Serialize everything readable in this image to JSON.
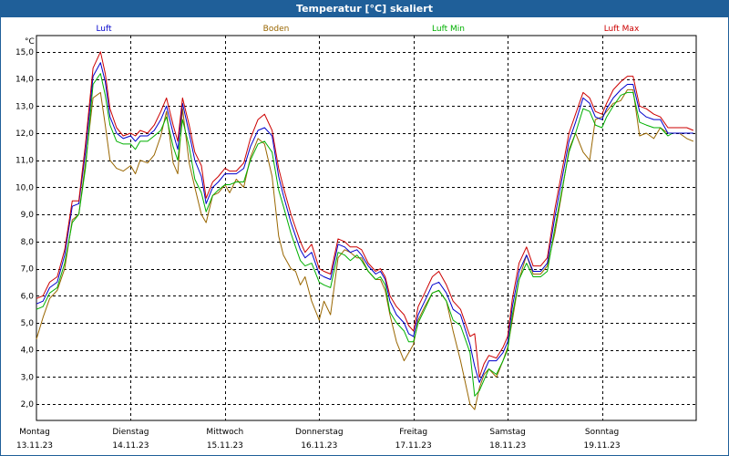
{
  "window": {
    "title": "Temperatur [°C] skaliert"
  },
  "chart_data": {
    "type": "line",
    "unit_label": "°C",
    "ylim": [
      1.4,
      15.6
    ],
    "y_ticks": [
      2.0,
      3.0,
      4.0,
      5.0,
      6.0,
      7.0,
      8.0,
      9.0,
      10.0,
      11.0,
      12.0,
      13.0,
      14.0,
      15.0
    ],
    "y_tick_labels": [
      "2,0",
      "3,0",
      "4,0",
      "5,0",
      "6,0",
      "7,0",
      "8,0",
      "9,0",
      "10,0",
      "11,0",
      "12,0",
      "13,0",
      "14,0",
      "15,0"
    ],
    "xlim": [
      0,
      7
    ],
    "x_ticks": [
      {
        "pos": 0,
        "day": "Montag",
        "date": "13.11.23"
      },
      {
        "pos": 1,
        "day": "Dienstag",
        "date": "14.11.23"
      },
      {
        "pos": 2,
        "day": "Mittwoch",
        "date": "15.11.23"
      },
      {
        "pos": 3,
        "day": "Donnerstag",
        "date": "16.11.23"
      },
      {
        "pos": 4,
        "day": "Freitag",
        "date": "17.11.23"
      },
      {
        "pos": 5,
        "day": "Samstag",
        "date": "18.11.23"
      },
      {
        "pos": 6,
        "day": "Sonntag",
        "date": "19.11.23"
      }
    ],
    "grid": true,
    "legend_position": "top",
    "series": [
      {
        "name": "Luft",
        "color": "#0000cc",
        "x": [
          0,
          0.07,
          0.14,
          0.22,
          0.3,
          0.38,
          0.45,
          0.52,
          0.6,
          0.68,
          0.73,
          0.78,
          0.85,
          0.92,
          1.0,
          1.05,
          1.1,
          1.18,
          1.25,
          1.32,
          1.38,
          1.45,
          1.5,
          1.55,
          1.62,
          1.68,
          1.75,
          1.8,
          1.87,
          1.93,
          2.0,
          2.05,
          2.12,
          2.2,
          2.27,
          2.35,
          2.42,
          2.5,
          2.57,
          2.62,
          2.7,
          2.75,
          2.8,
          2.85,
          2.92,
          3.0,
          3.05,
          3.12,
          3.2,
          3.27,
          3.33,
          3.4,
          3.45,
          3.52,
          3.6,
          3.65,
          3.7,
          3.75,
          3.82,
          3.9,
          3.95,
          4.0,
          4.05,
          4.12,
          4.2,
          4.27,
          4.35,
          4.42,
          4.5,
          4.6,
          4.65,
          4.7,
          4.75,
          4.8,
          4.88,
          4.95,
          5.0,
          5.05,
          5.12,
          5.2,
          5.27,
          5.35,
          5.42,
          5.5,
          5.57,
          5.65,
          5.72,
          5.8,
          5.87,
          5.93,
          6.0,
          6.05,
          6.12,
          6.2,
          6.27,
          6.33,
          6.4,
          6.47,
          6.55,
          6.62,
          6.7,
          6.75,
          6.82,
          6.9,
          6.97
        ],
        "y": [
          5.7,
          5.8,
          6.3,
          6.5,
          7.5,
          9.3,
          9.4,
          11.3,
          14.1,
          14.6,
          13.9,
          12.6,
          12.0,
          11.8,
          11.9,
          11.7,
          11.9,
          11.9,
          12.1,
          12.5,
          13.0,
          12.0,
          11.4,
          13.1,
          12.0,
          11.0,
          10.4,
          9.4,
          10.0,
          10.2,
          10.5,
          10.5,
          10.5,
          10.7,
          11.5,
          12.1,
          12.2,
          11.9,
          10.4,
          9.7,
          8.7,
          8.2,
          7.7,
          7.4,
          7.6,
          6.8,
          6.7,
          6.6,
          7.9,
          7.8,
          7.6,
          7.7,
          7.5,
          7.1,
          6.8,
          6.9,
          6.6,
          5.8,
          5.3,
          5.0,
          4.6,
          4.5,
          5.3,
          5.8,
          6.4,
          6.5,
          6.1,
          5.5,
          5.3,
          4.2,
          3.4,
          2.8,
          3.2,
          3.6,
          3.6,
          3.9,
          4.3,
          5.6,
          6.9,
          7.5,
          6.9,
          6.9,
          7.2,
          8.9,
          10.2,
          11.7,
          12.4,
          13.3,
          13.1,
          12.6,
          12.5,
          12.9,
          13.3,
          13.6,
          13.8,
          13.8,
          12.8,
          12.6,
          12.5,
          12.5,
          12.0,
          12.0,
          12.0,
          12.0,
          12.0
        ]
      },
      {
        "name": "Boden",
        "color": "#996600",
        "x": [
          0,
          0.07,
          0.14,
          0.22,
          0.3,
          0.38,
          0.45,
          0.52,
          0.6,
          0.68,
          0.73,
          0.78,
          0.85,
          0.92,
          1.0,
          1.05,
          1.1,
          1.18,
          1.25,
          1.32,
          1.38,
          1.45,
          1.5,
          1.55,
          1.62,
          1.68,
          1.75,
          1.8,
          1.87,
          1.93,
          2.0,
          2.05,
          2.12,
          2.2,
          2.27,
          2.35,
          2.42,
          2.5,
          2.57,
          2.62,
          2.7,
          2.75,
          2.8,
          2.85,
          2.92,
          3.0,
          3.05,
          3.12,
          3.2,
          3.27,
          3.33,
          3.4,
          3.45,
          3.52,
          3.6,
          3.65,
          3.7,
          3.75,
          3.82,
          3.9,
          3.95,
          4.0,
          4.05,
          4.12,
          4.2,
          4.27,
          4.35,
          4.42,
          4.5,
          4.6,
          4.65,
          4.7,
          4.75,
          4.8,
          4.88,
          4.95,
          5.0,
          5.05,
          5.12,
          5.2,
          5.27,
          5.35,
          5.42,
          5.5,
          5.57,
          5.65,
          5.72,
          5.8,
          5.87,
          5.93,
          6.0,
          6.05,
          6.12,
          6.2,
          6.27,
          6.33,
          6.4,
          6.47,
          6.55,
          6.62,
          6.7,
          6.75,
          6.82,
          6.9,
          6.97
        ],
        "y": [
          4.4,
          5.2,
          5.9,
          6.2,
          7.0,
          8.8,
          9.0,
          10.9,
          13.3,
          13.5,
          12.3,
          11.0,
          10.7,
          10.6,
          10.8,
          10.5,
          11.0,
          10.9,
          11.2,
          11.9,
          12.8,
          10.9,
          10.5,
          12.9,
          10.9,
          10.0,
          9.0,
          8.7,
          9.7,
          9.8,
          10.1,
          9.8,
          10.3,
          10.0,
          11.1,
          11.8,
          11.6,
          10.4,
          8.2,
          7.5,
          7.0,
          6.9,
          6.4,
          6.7,
          5.8,
          5.1,
          5.8,
          5.3,
          7.4,
          7.7,
          7.6,
          7.4,
          7.4,
          6.9,
          6.6,
          6.6,
          6.2,
          5.3,
          4.3,
          3.6,
          3.9,
          4.2,
          5.1,
          5.6,
          6.1,
          6.2,
          5.8,
          4.7,
          3.6,
          2.0,
          1.8,
          2.6,
          3.1,
          3.3,
          3.0,
          3.6,
          4.1,
          5.1,
          6.6,
          7.5,
          6.8,
          6.8,
          7.1,
          8.3,
          9.7,
          11.4,
          12.0,
          11.3,
          11.0,
          12.5,
          12.6,
          12.8,
          13.1,
          13.2,
          13.6,
          13.6,
          11.9,
          12.0,
          11.8,
          12.2,
          12.0,
          12.0,
          12.0,
          11.8,
          11.7
        ]
      },
      {
        "name": "Luft Min",
        "color": "#00b000",
        "x": [
          0,
          0.07,
          0.14,
          0.22,
          0.3,
          0.38,
          0.45,
          0.52,
          0.6,
          0.68,
          0.73,
          0.78,
          0.85,
          0.92,
          1.0,
          1.05,
          1.1,
          1.18,
          1.25,
          1.32,
          1.38,
          1.45,
          1.5,
          1.55,
          1.62,
          1.68,
          1.75,
          1.8,
          1.87,
          1.93,
          2.0,
          2.05,
          2.12,
          2.2,
          2.27,
          2.35,
          2.42,
          2.5,
          2.57,
          2.62,
          2.7,
          2.75,
          2.8,
          2.85,
          2.92,
          3.0,
          3.05,
          3.12,
          3.2,
          3.27,
          3.33,
          3.4,
          3.45,
          3.52,
          3.6,
          3.65,
          3.7,
          3.75,
          3.82,
          3.9,
          3.95,
          4.0,
          4.05,
          4.12,
          4.2,
          4.27,
          4.35,
          4.42,
          4.5,
          4.6,
          4.65,
          4.7,
          4.75,
          4.8,
          4.88,
          4.95,
          5.0,
          5.05,
          5.12,
          5.2,
          5.27,
          5.35,
          5.42,
          5.5,
          5.57,
          5.65,
          5.72,
          5.8,
          5.87,
          5.93,
          6.0,
          6.05,
          6.12,
          6.2,
          6.27,
          6.33,
          6.4,
          6.47,
          6.55,
          6.62,
          6.7,
          6.75,
          6.82,
          6.9,
          6.97
        ],
        "y": [
          5.5,
          5.6,
          6.1,
          6.3,
          7.2,
          8.7,
          9.0,
          10.7,
          13.8,
          14.2,
          13.4,
          12.3,
          11.7,
          11.6,
          11.6,
          11.4,
          11.7,
          11.7,
          11.9,
          12.1,
          12.6,
          11.5,
          11.0,
          12.5,
          11.5,
          10.3,
          9.8,
          9.1,
          9.7,
          9.9,
          10.1,
          10.1,
          10.2,
          10.2,
          11.0,
          11.6,
          11.7,
          11.3,
          9.9,
          9.3,
          8.3,
          7.8,
          7.3,
          7.1,
          7.2,
          6.5,
          6.4,
          6.3,
          7.6,
          7.5,
          7.3,
          7.5,
          7.3,
          6.9,
          6.6,
          6.7,
          6.4,
          5.4,
          5.0,
          4.7,
          4.3,
          4.3,
          5.0,
          5.5,
          6.1,
          6.2,
          5.8,
          5.1,
          4.9,
          3.9,
          2.3,
          2.5,
          2.9,
          3.3,
          3.1,
          3.6,
          4.0,
          5.3,
          6.6,
          7.2,
          6.7,
          6.7,
          6.9,
          8.5,
          9.8,
          11.3,
          12.0,
          12.9,
          12.8,
          12.3,
          12.2,
          12.6,
          13.0,
          13.4,
          13.5,
          13.5,
          12.4,
          12.3,
          12.2,
          12.2,
          11.9,
          12.0,
          12.0,
          12.0,
          12.0
        ]
      },
      {
        "name": "Luft Max",
        "color": "#cc0000",
        "x": [
          0,
          0.07,
          0.14,
          0.22,
          0.3,
          0.38,
          0.45,
          0.52,
          0.6,
          0.68,
          0.73,
          0.78,
          0.85,
          0.92,
          1.0,
          1.05,
          1.1,
          1.18,
          1.25,
          1.32,
          1.38,
          1.45,
          1.5,
          1.55,
          1.62,
          1.68,
          1.75,
          1.8,
          1.87,
          1.93,
          2.0,
          2.05,
          2.12,
          2.2,
          2.27,
          2.35,
          2.42,
          2.5,
          2.57,
          2.62,
          2.7,
          2.75,
          2.8,
          2.85,
          2.92,
          3.0,
          3.05,
          3.12,
          3.2,
          3.27,
          3.33,
          3.4,
          3.45,
          3.52,
          3.6,
          3.65,
          3.7,
          3.75,
          3.82,
          3.9,
          3.95,
          4.0,
          4.05,
          4.12,
          4.2,
          4.27,
          4.35,
          4.42,
          4.5,
          4.6,
          4.65,
          4.7,
          4.75,
          4.8,
          4.88,
          4.95,
          5.0,
          5.05,
          5.12,
          5.2,
          5.27,
          5.35,
          5.42,
          5.5,
          5.57,
          5.65,
          5.72,
          5.8,
          5.87,
          5.93,
          6.0,
          6.05,
          6.12,
          6.2,
          6.27,
          6.33,
          6.4,
          6.47,
          6.55,
          6.62,
          6.7,
          6.75,
          6.82,
          6.9,
          6.97
        ],
        "y": [
          5.9,
          6.0,
          6.5,
          6.7,
          7.7,
          9.5,
          9.5,
          11.6,
          14.4,
          15.0,
          14.2,
          12.9,
          12.2,
          11.9,
          12.0,
          11.9,
          12.1,
          12.0,
          12.3,
          12.8,
          13.3,
          12.3,
          11.7,
          13.3,
          12.3,
          11.3,
          10.8,
          9.6,
          10.2,
          10.4,
          10.7,
          10.6,
          10.6,
          10.9,
          11.8,
          12.5,
          12.7,
          12.1,
          10.7,
          10.0,
          9.0,
          8.5,
          8.0,
          7.6,
          7.9,
          7.0,
          6.9,
          6.8,
          8.1,
          8.0,
          7.8,
          7.8,
          7.7,
          7.2,
          6.9,
          7.0,
          6.7,
          6.0,
          5.6,
          5.3,
          4.9,
          4.7,
          5.6,
          6.1,
          6.7,
          6.9,
          6.4,
          5.8,
          5.5,
          4.5,
          4.6,
          3.0,
          3.5,
          3.8,
          3.7,
          4.1,
          4.5,
          5.9,
          7.2,
          7.8,
          7.1,
          7.1,
          7.4,
          9.2,
          10.5,
          12.0,
          12.7,
          13.5,
          13.3,
          12.8,
          12.7,
          13.1,
          13.6,
          13.9,
          14.1,
          14.1,
          13.0,
          12.9,
          12.7,
          12.6,
          12.2,
          12.2,
          12.2,
          12.2,
          12.1
        ]
      }
    ]
  }
}
